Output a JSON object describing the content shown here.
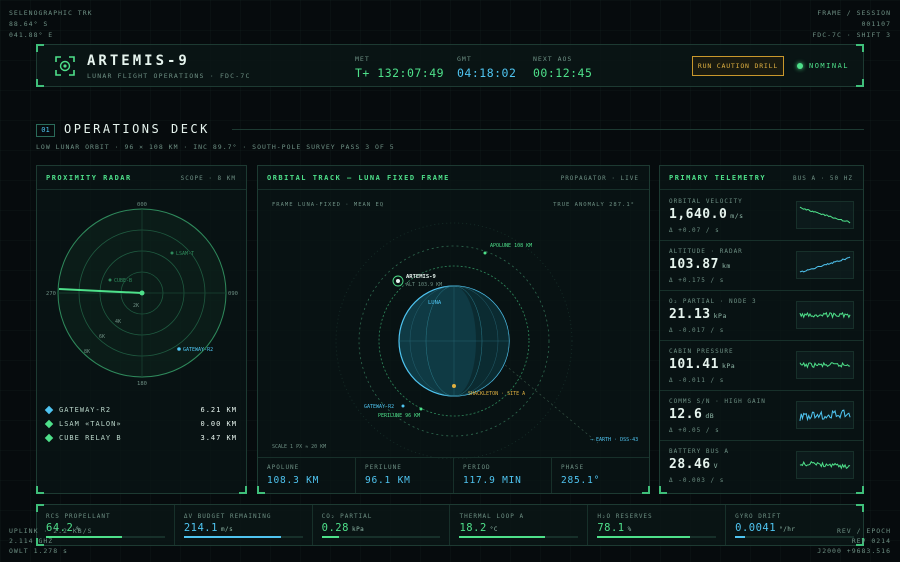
{
  "corners": {
    "top_left": [
      "SELENOGRAPHIC TRK",
      "88.64° S",
      "041.88° E"
    ],
    "top_right": [
      "FRAME / SESSION",
      "001107",
      "FDC-7C · SHIFT 3"
    ],
    "bottom_left": [
      "UPLINK · 2.2 KB/S",
      "2.114 GHZ",
      "OWLT 1.278 s"
    ],
    "bottom_right": [
      "REV / EPOCH",
      "REV 0214",
      "J2000 +9683.516"
    ]
  },
  "header": {
    "title": "ARTEMIS-9",
    "subtitle": "LUNAR FLIGHT OPERATIONS · FDC-7C",
    "met_label": "MET",
    "met_value": "T+ 132:07:49",
    "gmt_label": "GMT",
    "gmt_value": "04:18:02",
    "aos_label": "NEXT AOS",
    "aos_value": "00:12:45",
    "drill_button": "RUN CAUTION DRILL",
    "status": "NOMINAL"
  },
  "deck": {
    "number": "01",
    "title": "OPERATIONS DECK",
    "subtitle": "LOW LUNAR ORBIT · 96 × 108 KM · INC 89.7° · SOUTH-POLE SURVEY PASS 3 OF 5"
  },
  "radar": {
    "title": "PROXIMITY RADAR",
    "scope": "SCOPE · 8 KM",
    "bearings": [
      "000",
      "090",
      "180",
      "270"
    ],
    "rings": [
      "2K",
      "4K",
      "6K",
      "8K"
    ],
    "blips": [
      {
        "label": "GATEWAY-R2",
        "color": "#4fc4f0"
      },
      {
        "label": "CUBE-B",
        "color": "#4ee08a"
      },
      {
        "label": "LSAM-T",
        "color": "#4ee08a"
      }
    ],
    "contacts": [
      {
        "name": "GATEWAY-R2",
        "range": "6.21 KM",
        "color": "#4fc4f0"
      },
      {
        "name": "LSAM «TALON»",
        "range": "0.00 KM",
        "color": "#4ee08a"
      },
      {
        "name": "CUBE RELAY B",
        "range": "3.47 KM",
        "color": "#4ee08a"
      }
    ]
  },
  "orbit": {
    "title": "ORBITAL TRACK — LUNA FIXED FRAME",
    "propagator": "PROPAGATOR · LIVE",
    "frame_label": "FRAME LUNA-FIXED · MEAN EQ",
    "anomaly_label": "TRUE ANOMALY 287.1°",
    "moon_label": "LUNA",
    "craft_name": "ARTEMIS-9",
    "craft_alt": "ALT 103.9 KM",
    "apolune_marker": "APOLUNE 108 KM",
    "perilune_marker": "PERILUNE 96 KM",
    "gateway_marker": "GATEWAY-R2",
    "site_marker": "SHACKLETON · SITE A",
    "earth_marker": "→ EARTH · DSS-43",
    "scale_label": "SCALE 1 PX ≈ 20 KM",
    "stats": [
      {
        "label": "APOLUNE",
        "value": "108.3 KM"
      },
      {
        "label": "PERILUNE",
        "value": "96.1 KM"
      },
      {
        "label": "PERIOD",
        "value": "117.9 MIN"
      },
      {
        "label": "PHASE",
        "value": "285.1°"
      }
    ]
  },
  "telemetry": {
    "title": "PRIMARY TELEMETRY",
    "bus": "BUS A · 50 HZ",
    "rows": [
      {
        "label": "ORBITAL VELOCITY",
        "value": "1,640.0",
        "unit": "m/s",
        "delta": "Δ +0.07 / s",
        "spark_color": "#4ee08a",
        "trend": "down"
      },
      {
        "label": "ALTITUDE · RADAR",
        "value": "103.87",
        "unit": "km",
        "delta": "Δ +0.175 / s",
        "spark_color": "#4fc4f0",
        "trend": "up"
      },
      {
        "label": "O₂ PARTIAL · NODE 3",
        "value": "21.13",
        "unit": "kPa",
        "delta": "Δ -0.017 / s",
        "spark_color": "#4ee08a",
        "trend": "noise"
      },
      {
        "label": "CABIN PRESSURE",
        "value": "101.41",
        "unit": "kPa",
        "delta": "Δ -0.011 / s",
        "spark_color": "#4ee08a",
        "trend": "noise"
      },
      {
        "label": "COMMS S/N · HIGH GAIN",
        "value": "12.6",
        "unit": "dB",
        "delta": "Δ +0.05 / s",
        "spark_color": "#4fc4f0",
        "trend": "noisy"
      },
      {
        "label": "BATTERY BUS A",
        "value": "28.46",
        "unit": "V",
        "delta": "Δ -0.003 / s",
        "spark_color": "#4ee08a",
        "trend": "noise-down"
      }
    ]
  },
  "consumables": [
    {
      "label": "RCS PROPELLANT",
      "value": "64.2",
      "unit": "%",
      "fill": 0.642,
      "color": "#4ee08a"
    },
    {
      "label": "ΔV BUDGET REMAINING",
      "value": "214.1",
      "unit": "m/s",
      "fill": 0.82,
      "color": "#4fc4f0"
    },
    {
      "label": "CO₂ PARTIAL",
      "value": "0.28",
      "unit": "kPa",
      "fill": 0.15,
      "color": "#4ee08a"
    },
    {
      "label": "THERMAL LOOP A",
      "value": "18.2",
      "unit": "°C",
      "fill": 0.72,
      "color": "#4ee08a"
    },
    {
      "label": "H₂O RESERVES",
      "value": "78.1",
      "unit": "%",
      "fill": 0.781,
      "color": "#4ee08a"
    },
    {
      "label": "GYRO DRIFT",
      "value": "0.0041",
      "unit": "°/hr",
      "fill": 0.08,
      "color": "#4fc4f0"
    }
  ]
}
